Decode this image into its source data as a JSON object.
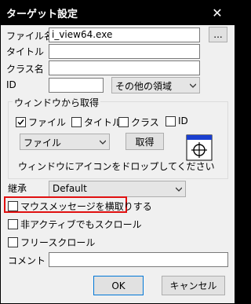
{
  "window": {
    "title": "ターゲット設定",
    "close_glyph": "✕"
  },
  "fields": {
    "filename": {
      "label": "ファイル名",
      "value": "i_view64.exe",
      "browse_label": "..."
    },
    "title": {
      "label": "タイトル",
      "value": ""
    },
    "classname": {
      "label": "クラス名",
      "value": ""
    },
    "id": {
      "label": "ID",
      "value": "",
      "region_selected": "その他の領域"
    }
  },
  "acquire_group": {
    "title": "ウィンドウから取得",
    "checkboxes": [
      {
        "label": "ファイル",
        "checked": true
      },
      {
        "label": "タイトル",
        "checked": false
      },
      {
        "label": "クラス",
        "checked": false
      },
      {
        "label": "ID",
        "checked": false
      }
    ],
    "source_selected": "ファイル",
    "acquire_button": "取得",
    "drop_hint": "ウィンドウにアイコンをドロップしてください",
    "drop_icon": "crosshair-target-icon"
  },
  "inherit": {
    "label": "継承",
    "selected": "Default"
  },
  "options": [
    {
      "label": "マウスメッセージを横取りする",
      "checked": false,
      "highlighted": true,
      "highlight_color": "#e01010"
    },
    {
      "label": "非アクティブでもスクロール",
      "checked": false
    },
    {
      "label": "フリースクロール",
      "checked": false
    }
  ],
  "comment": {
    "label": "コメント",
    "value": ""
  },
  "buttons": {
    "ok": "OK",
    "cancel": "キャンセル"
  }
}
